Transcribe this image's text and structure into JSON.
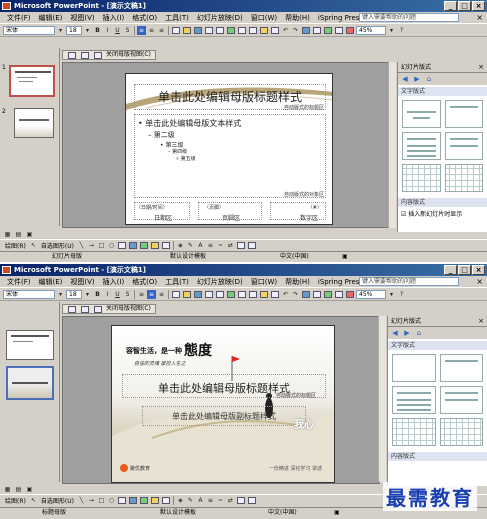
{
  "window": {
    "title": "Microsoft PowerPoint - [演示文稿1]",
    "win_buttons": [
      "_",
      "□",
      "×"
    ]
  },
  "menu": [
    "文件(F)",
    "编辑(E)",
    "视图(V)",
    "插入(I)",
    "格式(O)",
    "工具(T)",
    "幻灯片放映(D)",
    "窗口(W)",
    "帮助(H)",
    "iSpring Presenter"
  ],
  "help_placeholder": "键入需要帮助的问题",
  "toolbar": {
    "font": "宋体",
    "size": "18",
    "zoom": "45%",
    "bold": "B",
    "italic": "I",
    "underline": "U",
    "shadow": "S"
  },
  "master_toolbar": {
    "title": "幻灯片母版视图",
    "close_label": "关闭母版视图(C)"
  },
  "slide1": {
    "title": "单击此处编辑母版标题样式",
    "autolayout_title": "自动版式的标题区",
    "body_levels": [
      "• 单击此处编辑母版文本样式",
      "– 第二级",
      "• 第三级",
      "– 第四级",
      "» 第五级"
    ],
    "autolayout_object": "自动版式的对象区",
    "date_label": "〈日期/时间〉",
    "date_area": "日期区",
    "footer_label": "〈页脚〉",
    "footer_area": "页脚区",
    "number_label": "〈#〉",
    "number_area": "数字区"
  },
  "slide2": {
    "slogan_line1": "容智生活，是一种",
    "slogan_big": "態度",
    "slogan_line2": "自信的灵魂 掌控人生之",
    "title": "单击此处编辑母版标题样式",
    "autolayout_title": "自动版式的标题区",
    "subtitle": "单击此处编辑母版副标题样式",
    "logo_text": "聚优教育",
    "footer_text": "一份精进 深化学习 讲述",
    "calligraphy": "我心"
  },
  "taskpane": {
    "title": "幻灯片版式",
    "nav": [
      "◀",
      "▶",
      "⌂"
    ],
    "section_text": "文字版式",
    "section_content": "内容版式",
    "checkbox_label": "插入新幻灯片时显示"
  },
  "statusbar1": {
    "view": "幻灯片母版",
    "template": "默认设计模板",
    "language": "中文(中国)"
  },
  "statusbar2": {
    "view": "标题母版",
    "template": "默认设计模板",
    "language": "中文(中国)"
  },
  "drawbar": {
    "draw": "绘图(R)",
    "autoshapes": "自选图形(U)"
  },
  "thumbnails": [
    "1",
    "2"
  ],
  "watermark": "最需教育",
  "colors": {
    "titlebar_start": "#0a246a",
    "titlebar_end": "#3a6ea5",
    "selection_border": "#c0504d",
    "watermark": "#1a3fb3"
  }
}
